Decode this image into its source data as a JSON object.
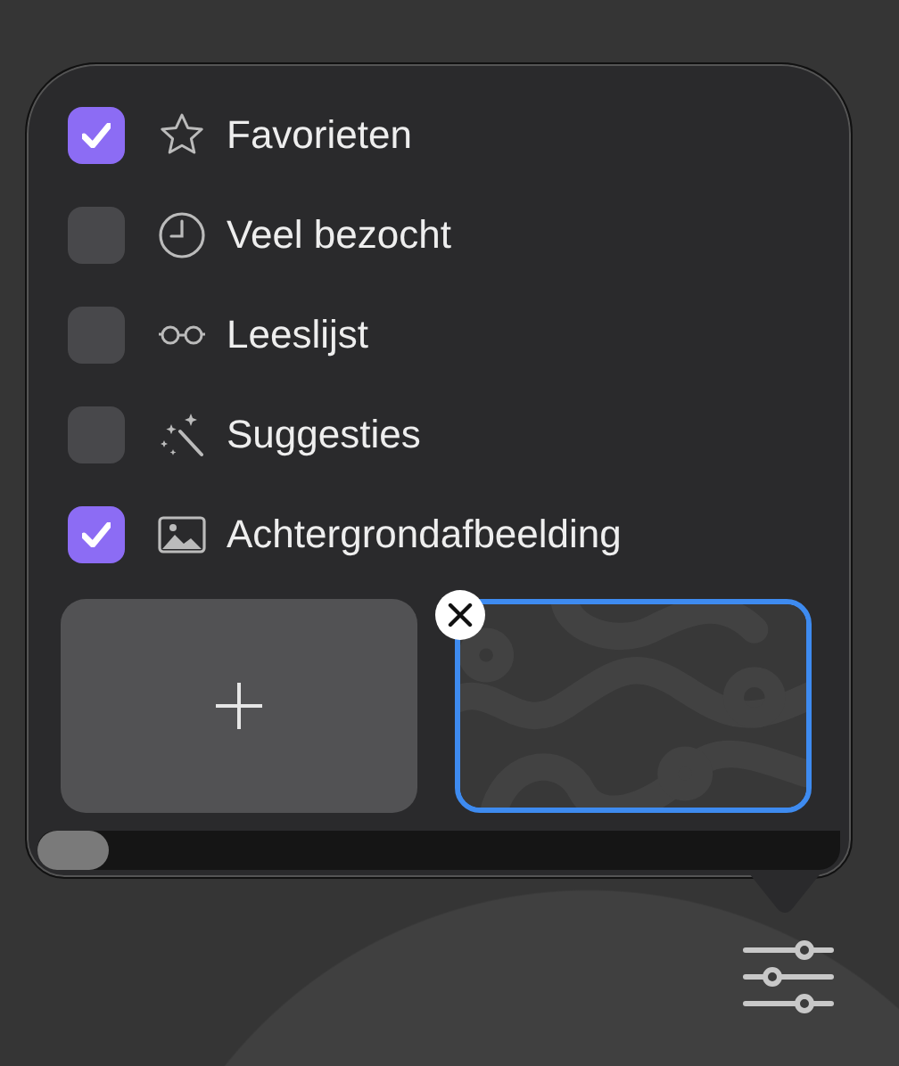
{
  "items": [
    {
      "label": "Favorieten",
      "checked": true
    },
    {
      "label": "Veel bezocht",
      "checked": false
    },
    {
      "label": "Leeslijst",
      "checked": false
    },
    {
      "label": "Suggesties",
      "checked": false
    },
    {
      "label": "Achtergrondafbeelding",
      "checked": true
    }
  ],
  "wallpapers": [
    {
      "kind": "add",
      "selected": false
    },
    {
      "kind": "picture",
      "selected": true
    }
  ]
}
